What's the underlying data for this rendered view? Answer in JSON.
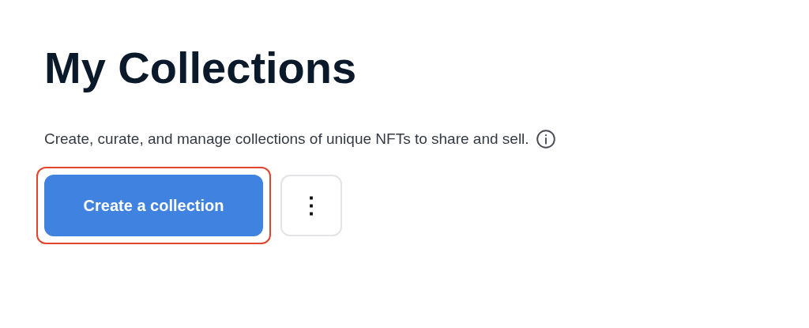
{
  "title": "My Collections",
  "description": "Create, curate, and manage collections of unique NFTs to share and sell.",
  "primary_button": {
    "label": "Create a collection",
    "highlighted": true
  },
  "more_button": {
    "label": "⋮"
  }
}
